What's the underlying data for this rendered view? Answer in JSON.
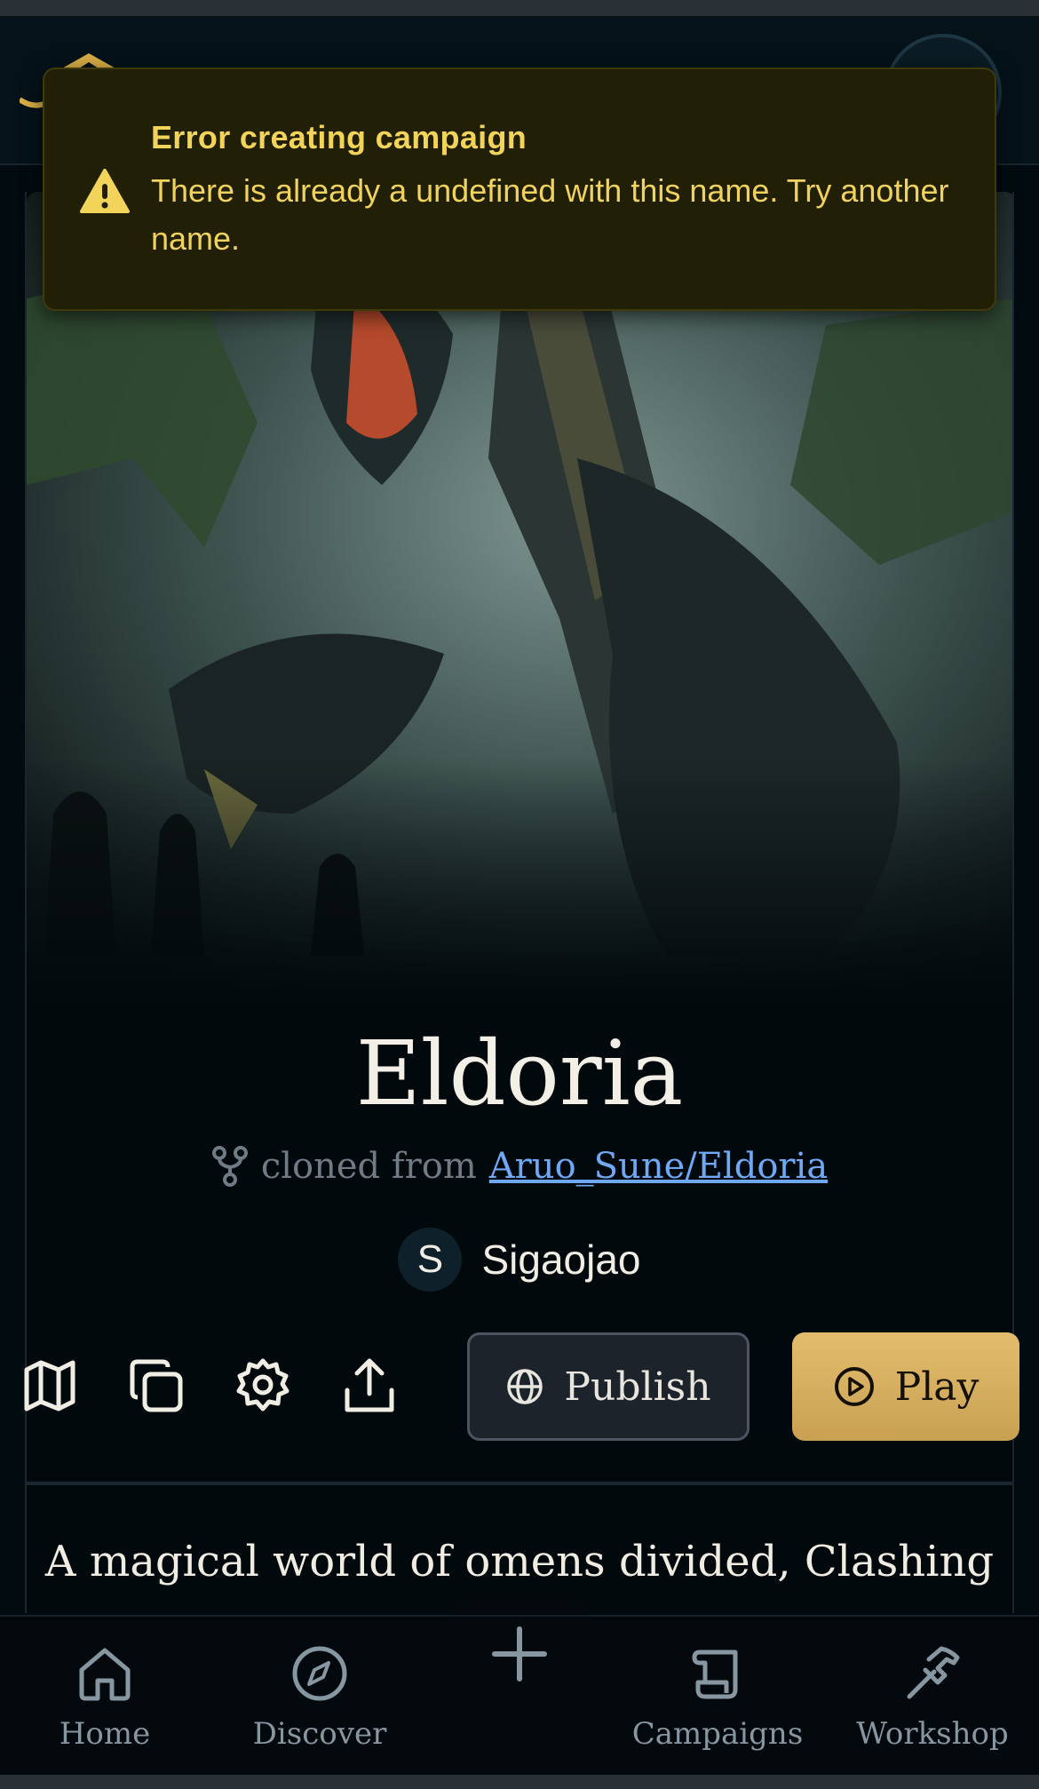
{
  "toast": {
    "title": "Error creating campaign",
    "message": "There is already a undefined with this name. Try another name.",
    "icon": "warning-icon"
  },
  "campaign": {
    "title": "Eldoria",
    "cloned_prefix": "cloned from",
    "cloned_source": "Aruo_Sune/Eldoria",
    "author_initial": "S",
    "author_name": "Sigaojao",
    "description": "A magical world of omens divided, Clashing"
  },
  "actions": {
    "icons": [
      "map-icon",
      "copy-icon",
      "settings-icon",
      "share-icon"
    ],
    "publish_label": "Publish",
    "play_label": "Play"
  },
  "nav": {
    "home": "Home",
    "discover": "Discover",
    "campaigns": "Campaigns",
    "workshop": "Workshop"
  },
  "colors": {
    "accent": "#d4ad5e",
    "link": "#6fa9f5",
    "toast_bg": "#211f05",
    "toast_text": "#f2d45a"
  }
}
